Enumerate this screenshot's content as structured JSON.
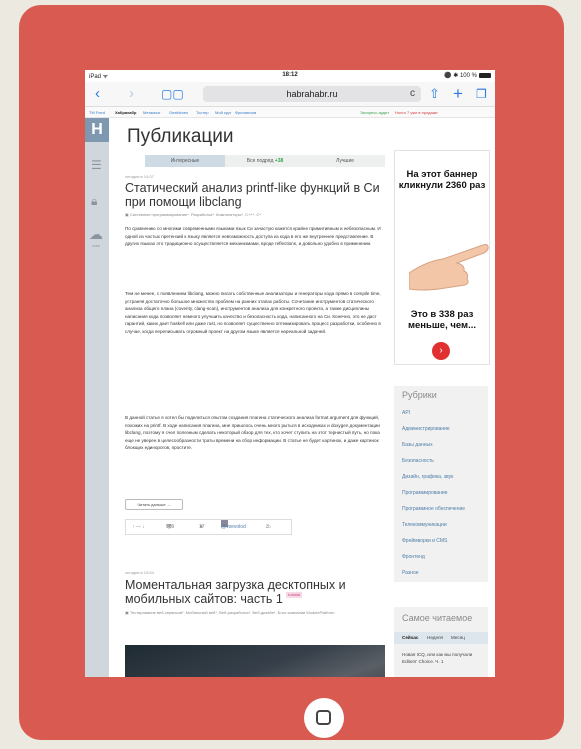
{
  "status_bar": {
    "left": "iPad ᯤ",
    "time": "18:12",
    "right": "⚫ ✱ 100 %"
  },
  "browser": {
    "url": "habrahabr.ru",
    "reload": "c"
  },
  "bookmarks": [
    "TM Feed",
    "Хабрахабр",
    "Мегамозг",
    "Geektimes",
    "Тостер",
    "Мой круг",
    "Фрилансим",
    "Экспресс-аудит",
    "Honor 7 уже в продаже"
  ],
  "sidebar": {
    "logo": "H",
    "cloud_label": "КАБИ"
  },
  "page": {
    "title": "Публикации"
  },
  "tabs": [
    {
      "label": "Интересные"
    },
    {
      "label": "Все подряд",
      "count": "+38"
    },
    {
      "label": "Лучшие"
    }
  ],
  "post1": {
    "time": "сегодня в 14:07",
    "title": "Статический анализ printf-like функций в Си при помощи libclang",
    "hubs": "Системное программирование*, Разработка*, Компиляторы*, C++*, C*",
    "p1": "По сравнению со многими современными языками язык Си зачастую кажется крайне примитивным и небезопасным. И одной из частых претензий к языку является невозможность доступа из кода в его же внутреннее представление. В других языках это традиционно осуществляется механизмами, вроде reflections, и довольно удобно в применении.",
    "p2": "Тем не менее, с появлением libclang, можно писать собственные анализаторы и генераторы кода прямо в compile time, устраняя достаточно большое множество проблем на ранних этапах работы. Сочетание инструментов статического анализа общего плана (coverity, clang-scan), инструментов анализа для конкретного проекта, а также дисциплины написания кода позволяет немного улучшить качество и безопасность кода, написанного на Си. Конечно, это не даст гарантий, каких дает haskell или даже rust, но позволяет существенно оптимизировать процесс разработки, особенно в случае, когда переписывать огромный проект на другом языке является нереальной задачей.",
    "p3": "В данной статье я хотел бы поделиться опытом создания плагина статического анализа format argument для функций, похожих на printf. В ходе написания плагина, мне пришлось очень много рыться в исходниках и doxygen документации libclang, поэтому я счел полезным сделать некоторый обзор для тех, кто хочет ступить на этот тернистый путь, но пока еще не уверен в целесообразности траты времени на сбор информации. В статье не будет картинок, и даже картинок блокщих единорогов, простите.",
    "more": "Читать дальше →",
    "stats": {
      "rating": "↑ — ↓",
      "views": "989",
      "favs": "17",
      "author": "@vsevolod",
      "comments": "3"
    }
  },
  "post2": {
    "time": "сегодня в 13:54",
    "title": "Моментальная загрузка десктопных и мобильных сайтов: часть 1",
    "badge": "tutorial",
    "hubs": "Тестирование веб-сервисов*, Мобильный веб*, Веб-разработка*, Веб-дизайн*, Блог компании ModulePlatform"
  },
  "ad": {
    "top": "На этот баннер кликнули 2360 раз",
    "bottom": "Это в 338 раз меньше, чем..."
  },
  "rubrics": {
    "title": "Рубрики",
    "items": [
      "API",
      "Администрирование",
      "Базы данных",
      "Безопасность",
      "Дизайн, графика, звук",
      "Программирование",
      "Программное обеспечение",
      "Телекоммуникации",
      "Фреймворки и СМS",
      "Фронтенд",
      "Разное"
    ]
  },
  "top_read": {
    "title": "Самое читаемое",
    "tabs": [
      "Сейчас",
      "Неделя",
      "Месяц"
    ],
    "item": "Новая ICQ, или как мы получали Editors' Choice. Ч. 1"
  }
}
